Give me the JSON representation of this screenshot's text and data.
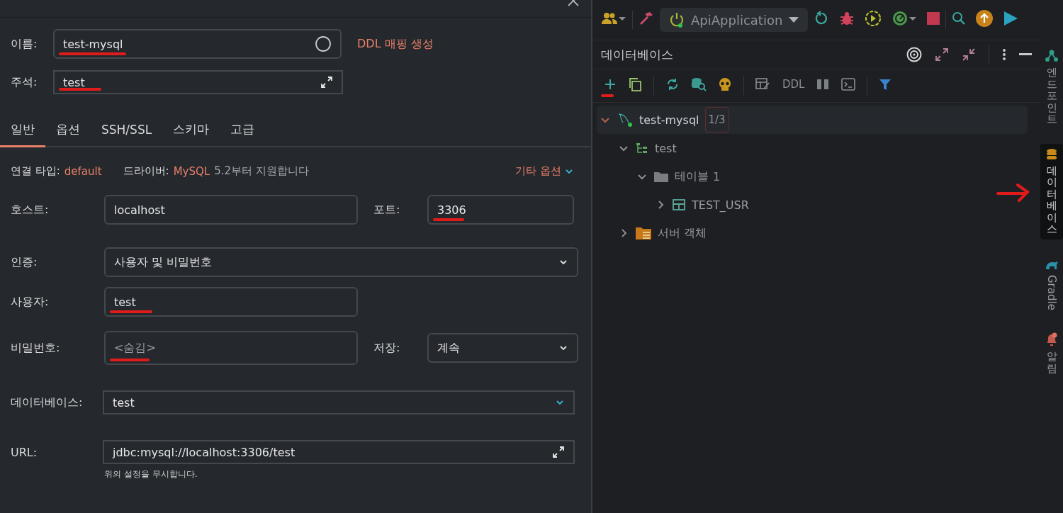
{
  "dialog": {
    "name": {
      "label": "이름:",
      "value": "test-mysql",
      "marked": true
    },
    "ddl_link": "DDL 매핑 생성",
    "comment": {
      "label": "주석:",
      "value": "test",
      "marked": true
    },
    "tabs": [
      {
        "label": "일반",
        "selected": true
      },
      {
        "label": "옵션",
        "selected": false
      },
      {
        "label": "SSH/SSL",
        "selected": false
      },
      {
        "label": "스키마",
        "selected": false
      },
      {
        "label": "고급",
        "selected": false
      }
    ],
    "info": {
      "type_label": "연결 타입:",
      "type_value": "default",
      "driver_label": "드라이버:",
      "driver_value": "MySQL",
      "driver_note": "5.2부터 지원합니다",
      "more_options": "기타 옵션"
    },
    "host": {
      "label": "호스트:",
      "value": "localhost",
      "marked": false
    },
    "port": {
      "label": "포트:",
      "value": "3306",
      "marked": true
    },
    "auth": {
      "label": "인증:",
      "value": "사용자 및 비밀번호"
    },
    "user": {
      "label": "사용자:",
      "value": "test",
      "marked": true
    },
    "password": {
      "label": "비밀번호:",
      "placeholder": "<숨김>",
      "marked": true
    },
    "save": {
      "label": "저장:",
      "value": "계속"
    },
    "database": {
      "label": "데이터베이스:",
      "value": "test"
    },
    "url": {
      "label": "URL:",
      "value": "jdbc:mysql://localhost:3306/test",
      "hint": "위의 설정을 무시합니다."
    }
  },
  "toolbar": {
    "run_config": "ApiApplication"
  },
  "db_panel": {
    "title": "데이터베이스",
    "tools": [
      {
        "kind": "add",
        "marked": true
      },
      {
        "kind": "copy",
        "marked": false
      },
      {
        "kind": "sep"
      },
      {
        "kind": "refresh",
        "marked": false
      },
      {
        "kind": "dbsearch",
        "marked": false
      },
      {
        "kind": "skull",
        "marked": false
      },
      {
        "kind": "sep"
      },
      {
        "kind": "tableedit",
        "marked": false
      },
      {
        "kind": "text",
        "label": "DDL",
        "marked": false
      },
      {
        "kind": "compare",
        "marked": false
      },
      {
        "kind": "console",
        "marked": false
      },
      {
        "kind": "sep"
      },
      {
        "kind": "filter",
        "marked": false
      }
    ],
    "tree": [
      {
        "kind": "datasource",
        "label": "test-mysql",
        "badge": "1/3",
        "expanded": true,
        "selected": true,
        "children": [
          {
            "kind": "schema",
            "label": "test",
            "expanded": true,
            "selected": false,
            "children": [
              {
                "kind": "folder",
                "label": "테이블",
                "count": "1",
                "expanded": true,
                "selected": false,
                "children": [
                  {
                    "kind": "table",
                    "label": "TEST_USR",
                    "expanded": false,
                    "selected": false
                  }
                ]
              }
            ]
          },
          {
            "kind": "server",
            "label": "서버 객체",
            "expanded": false,
            "selected": false
          }
        ]
      }
    ]
  },
  "side_tabs": [
    {
      "kind": "endpoints",
      "label": "엔드포인트",
      "selected": false,
      "marked": false
    },
    {
      "kind": "database",
      "label": "데이터베이스",
      "selected": true,
      "marked": true
    },
    {
      "kind": "gradle",
      "label": "Gradle",
      "selected": false,
      "marked": false
    },
    {
      "kind": "notifications",
      "label": "알림",
      "selected": false,
      "marked": false
    }
  ]
}
